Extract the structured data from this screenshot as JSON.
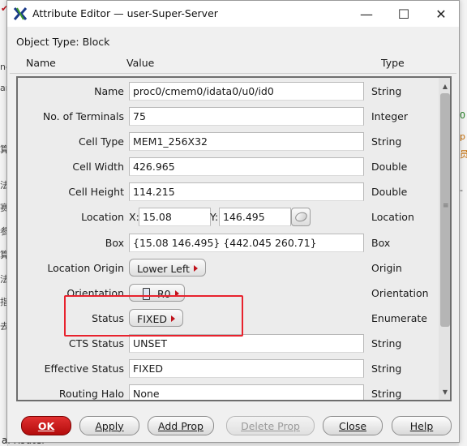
{
  "window": {
    "title": "Attribute Editor — user-Super-Server",
    "controls": {
      "minimize": "—",
      "maximize": "☐",
      "close": "✕"
    }
  },
  "object_type": {
    "label": "Object Type:",
    "value": "Block"
  },
  "columns": {
    "name": "Name",
    "value": "Value",
    "type": "Type"
  },
  "rows": [
    {
      "name": "Name",
      "value": "proc0/cmem0/idata0/u0/id0",
      "type": "String"
    },
    {
      "name": "No. of Terminals",
      "value": "75",
      "type": "Integer"
    },
    {
      "name": "Cell Type",
      "value": "MEM1_256X32",
      "type": "String"
    },
    {
      "name": "Cell Width",
      "value": "426.965",
      "type": "Double"
    },
    {
      "name": "Cell Height",
      "value": "114.215",
      "type": "Double"
    },
    {
      "name": "Location",
      "x_label": "X:",
      "x_value": "15.08",
      "y_label": "Y:",
      "y_value": "146.495",
      "type": "Location"
    },
    {
      "name": "Box",
      "value": "{15.08 146.495} {442.045 260.71}",
      "type": "Box"
    },
    {
      "name": "Location Origin",
      "value": "Lower Left",
      "type": "Origin"
    },
    {
      "name": "Orientation",
      "value": "R0",
      "type": "Orientation"
    },
    {
      "name": "Status",
      "value": "FIXED",
      "type": "Enumerate"
    },
    {
      "name": "CTS Status",
      "value": "UNSET",
      "type": "String"
    },
    {
      "name": "Effective Status",
      "value": "FIXED",
      "type": "String"
    },
    {
      "name": "Routing Halo",
      "value": "None",
      "type": "String"
    }
  ],
  "buttons": {
    "ok": "OK",
    "apply": "Apply",
    "add_prop": "Add Prop",
    "delete_prop": "Delete Prop",
    "close": "Close",
    "help": "Help"
  },
  "background": {
    "left_glyphs": [
      "nd",
      "ar",
      "算",
      "法",
      "赛",
      "参",
      "算",
      "法",
      "指",
      "去"
    ],
    "bottom_left_text": "al Router",
    "right_glyphs": [
      "0",
      "p",
      "员",
      "-"
    ]
  },
  "colors": {
    "highlight": "#e8222d",
    "ok_button": "#c81a1a",
    "menu_arrow": "#c0121b"
  }
}
